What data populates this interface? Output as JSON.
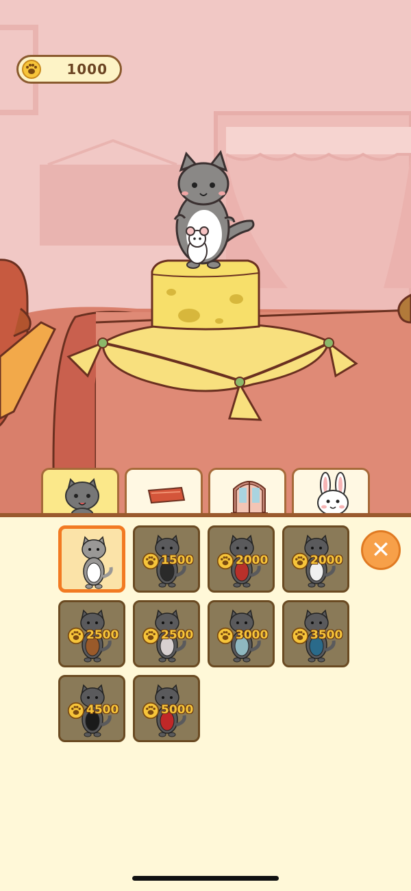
{
  "hud": {
    "coins": "1000",
    "coin_icon": "paw-coin-icon"
  },
  "tabs": [
    {
      "name": "cat",
      "icon": "cat-face-icon",
      "active": true
    },
    {
      "name": "cushion",
      "icon": "cushion-icon",
      "active": false
    },
    {
      "name": "door",
      "icon": "door-icon",
      "active": false
    },
    {
      "name": "bunny",
      "icon": "bunny-icon",
      "active": false
    }
  ],
  "shop": {
    "items": [
      {
        "id": "default",
        "price": "",
        "selected": true,
        "accent": "#ffffff"
      },
      {
        "id": "sunglasses",
        "price": "1500",
        "accent": "#2a2a2a"
      },
      {
        "id": "red-dress",
        "price": "2000",
        "accent": "#b8302a"
      },
      {
        "id": "cow",
        "price": "2000",
        "accent": "#f0f0f0"
      },
      {
        "id": "cowboy",
        "price": "2500",
        "accent": "#9a5a2a"
      },
      {
        "id": "princess",
        "price": "2500",
        "accent": "#d8d0d0"
      },
      {
        "id": "chef",
        "price": "3000",
        "accent": "#8fb8c0"
      },
      {
        "id": "pirate",
        "price": "3500",
        "accent": "#2a6a8a"
      },
      {
        "id": "black-dress",
        "price": "4500",
        "accent": "#1a1a1a"
      },
      {
        "id": "red-vest",
        "price": "5000",
        "accent": "#c02828"
      }
    ],
    "close_icon": "close-icon"
  },
  "colors": {
    "accent": "#f27a22",
    "panel": "#fff8d8",
    "gold": "#f7c53a"
  }
}
